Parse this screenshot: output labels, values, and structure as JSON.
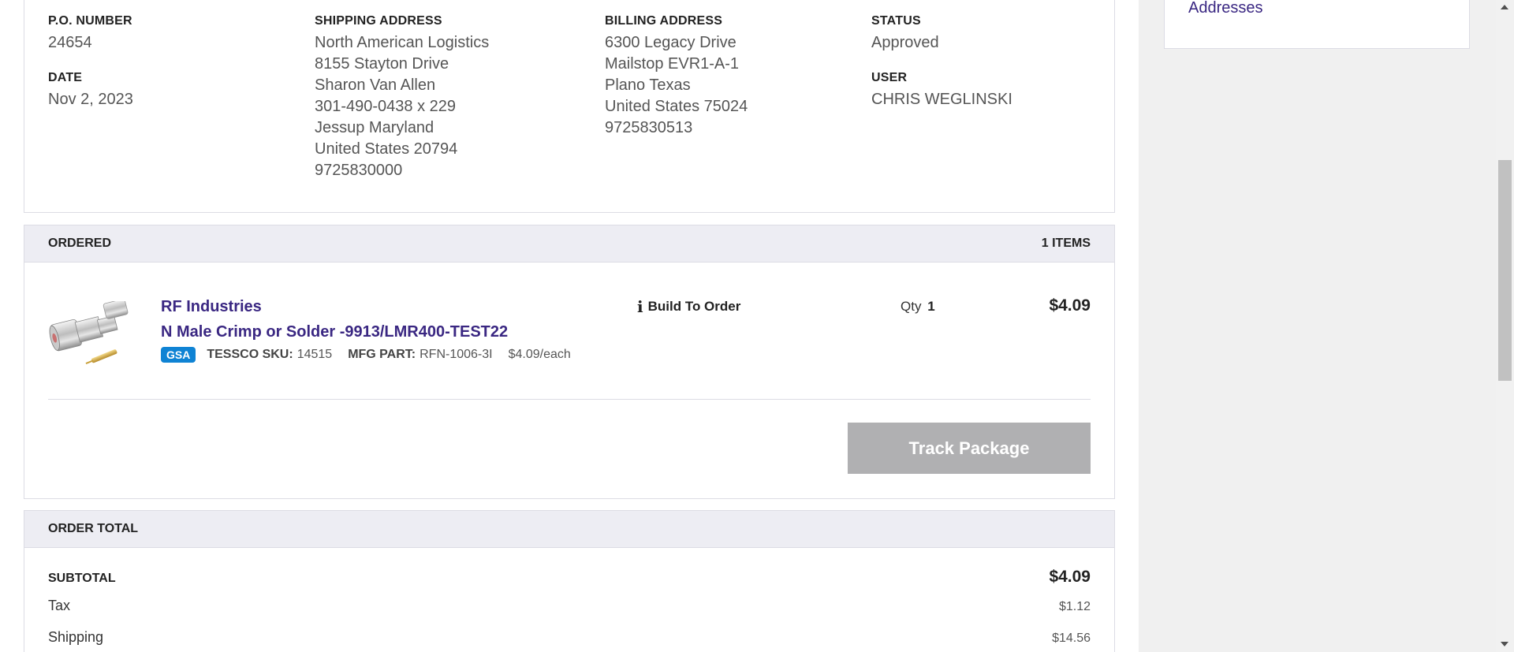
{
  "order_info": {
    "po_number": {
      "label": "P.O. NUMBER",
      "value": "24654"
    },
    "date": {
      "label": "DATE",
      "value": "Nov 2, 2023"
    },
    "shipping_address": {
      "label": "SHIPPING ADDRESS",
      "lines": [
        "North American Logistics",
        "8155 Stayton Drive",
        "Sharon Van Allen",
        "301-490-0438 x 229",
        "Jessup Maryland",
        "United States 20794",
        "9725830000"
      ]
    },
    "billing_address": {
      "label": "BILLING ADDRESS",
      "lines": [
        "6300 Legacy Drive",
        "Mailstop EVR1-A-1",
        "Plano Texas",
        "United States 75024",
        "9725830513"
      ]
    },
    "status": {
      "label": "STATUS",
      "value": "Approved"
    },
    "user": {
      "label": "USER",
      "value": "CHRIS WEGLINSKI"
    }
  },
  "ordered": {
    "header": "ORDERED",
    "count": "1 ITEMS",
    "item": {
      "brand": "RF Industries",
      "name": "N Male Crimp or Solder -9913/LMR400-TEST22",
      "badge": "GSA",
      "sku_label": "TESSCO SKU:",
      "sku": "14515",
      "mfg_label": "MFG PART:",
      "mfg": "RFN-1006-3I",
      "unit_price": "$4.09/each",
      "availability": "Build To Order",
      "availability_icon": "info-icon",
      "qty_label": "Qty",
      "qty": "1",
      "price": "$4.09"
    },
    "track_button": "Track Package"
  },
  "order_total": {
    "header": "ORDER TOTAL",
    "subtotal": {
      "label": "SUBTOTAL",
      "value": "$4.09"
    },
    "tax": {
      "label": "Tax",
      "value": "$1.12"
    },
    "shipping": {
      "label": "Shipping",
      "value": "$14.56"
    }
  },
  "sidebar": {
    "link": "Addresses"
  },
  "colors": {
    "link": "#3a2782",
    "gsa_badge": "#0f83d4",
    "section_header_bg": "#ededf3",
    "button_disabled": "#b0b0b2"
  }
}
